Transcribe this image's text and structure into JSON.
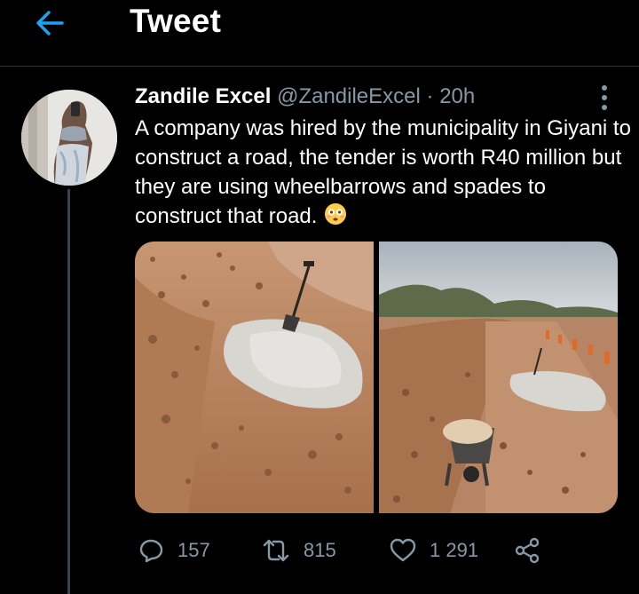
{
  "header": {
    "title": "Tweet",
    "back_icon": "arrow-left-icon"
  },
  "tweet": {
    "author_name": "Zandile Excel",
    "handle": "@ZandileExcel",
    "separator": "·",
    "time": "20h",
    "text": "A company was hired by the municipality in Giyani to construct a road, the tender is worth R40 million but they are using wheelbarrows and spades to construct that road.",
    "emoji_icon": "flushed-face-emoji"
  },
  "actions": {
    "replies": "157",
    "retweets": "815",
    "likes": "1 291"
  },
  "colors": {
    "background": "#000000",
    "accent": "#1da1f2",
    "secondary_text": "#8899a6",
    "divider": "#2f3336"
  }
}
